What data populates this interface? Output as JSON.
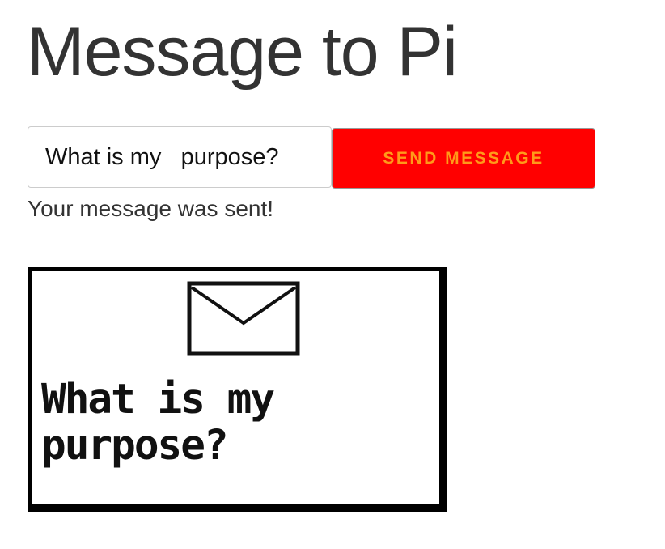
{
  "page": {
    "title": "Message to Pi"
  },
  "form": {
    "input_value": "What is my   purpose?",
    "send_label": "SEND MESSAGE"
  },
  "status": {
    "text": "Your message was sent!"
  },
  "display": {
    "icon": "envelope-icon",
    "message": "What is my\npurpose?"
  },
  "colors": {
    "button_background": "#ff0000",
    "button_text": "#ff9a1a",
    "display_border": "#000000"
  }
}
